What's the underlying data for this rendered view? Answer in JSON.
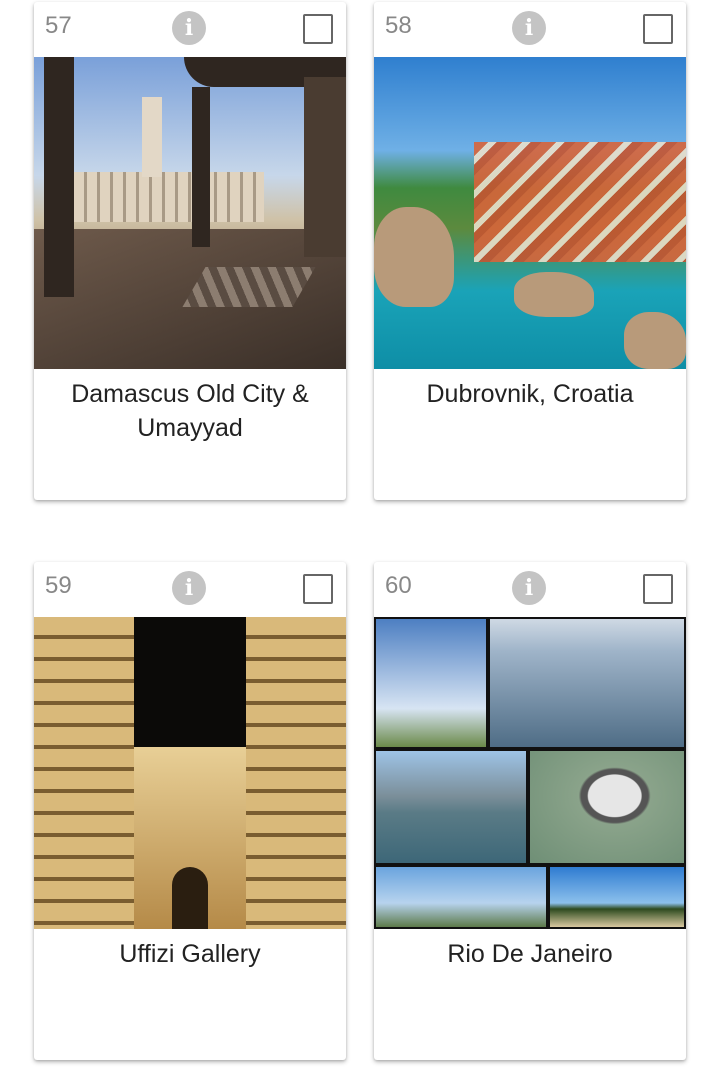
{
  "cards": [
    {
      "number": "57",
      "title": "Damascus Old City & Umayyad"
    },
    {
      "number": "58",
      "title": "Dubrovnik, Croatia"
    },
    {
      "number": "59",
      "title": "Uffizi Gallery"
    },
    {
      "number": "60",
      "title": "Rio De Janeiro"
    }
  ],
  "icons": {
    "info": "i"
  }
}
